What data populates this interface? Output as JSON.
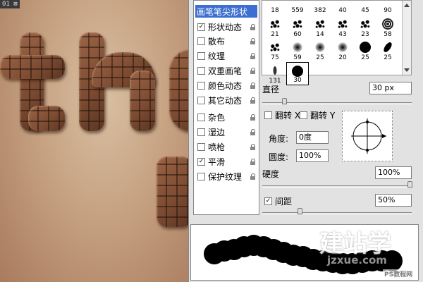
{
  "canvas": {
    "tab_label": "01"
  },
  "sidebar": {
    "header": "画笔笔尖形状",
    "items": [
      {
        "label": "形状动态",
        "checked": true
      },
      {
        "label": "散布",
        "checked": false
      },
      {
        "label": "纹理",
        "checked": false
      },
      {
        "label": "双重画笔",
        "checked": false
      },
      {
        "label": "颜色动态",
        "checked": false
      },
      {
        "label": "其它动态",
        "checked": false
      },
      {
        "label": "杂色",
        "checked": false
      },
      {
        "label": "湿边",
        "checked": false
      },
      {
        "label": "喷枪",
        "checked": false
      },
      {
        "label": "平滑",
        "checked": true
      },
      {
        "label": "保护纹理",
        "checked": false
      }
    ]
  },
  "brushes": {
    "row1": [
      "18",
      "559",
      "382",
      "40",
      "45",
      "90"
    ],
    "row2": [
      "21",
      "60",
      "14",
      "43",
      "23",
      "58"
    ],
    "row3": [
      "75",
      "59",
      "25",
      "20",
      "25",
      "25"
    ],
    "row4": [
      "131",
      "30"
    ]
  },
  "settings": {
    "diameter_label": "直径",
    "diameter_value": "30 px",
    "flip_x_label": "翻转 X",
    "flip_y_label": "翻转 Y",
    "angle_label": "角度:",
    "angle_value": "0度",
    "roundness_label": "圆度:",
    "roundness_value": "100%",
    "hardness_label": "硬度",
    "hardness_value": "100%",
    "spacing_label": "间距",
    "spacing_value": "50%",
    "spacing_checked": true
  },
  "watermark": {
    "cn": "建站学",
    "en": "jzxue.com",
    "ps": "PS教程网"
  }
}
